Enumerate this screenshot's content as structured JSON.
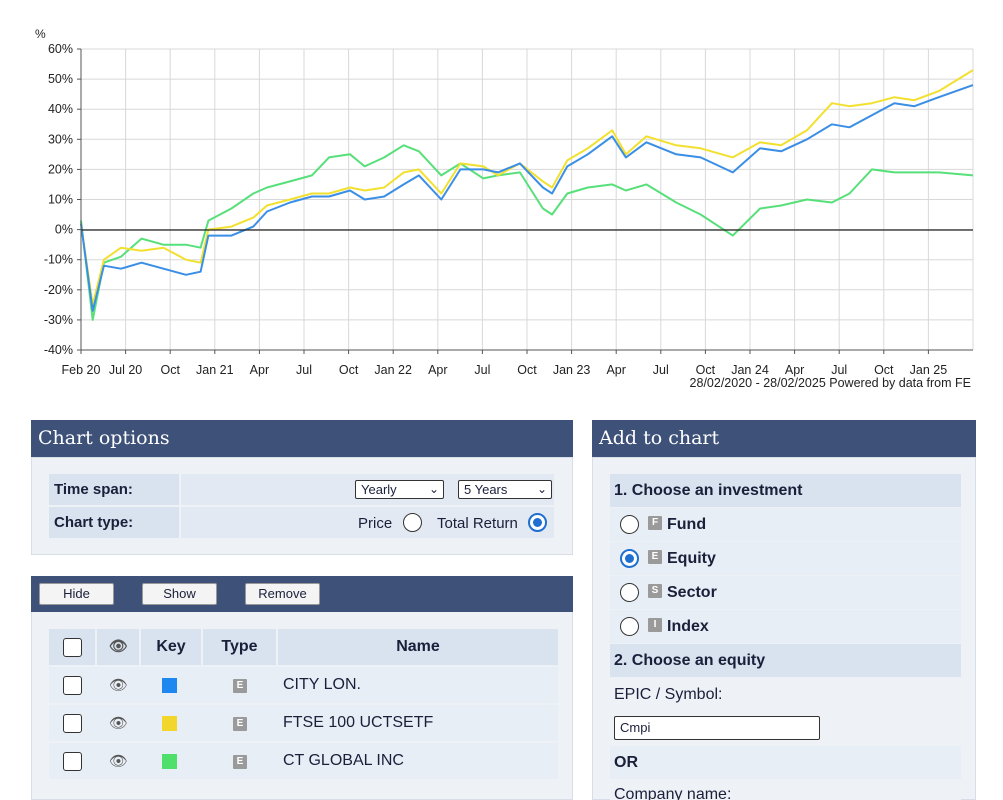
{
  "chart": {
    "y_unit": "%",
    "y_ticks": [
      "60%",
      "50%",
      "40%",
      "30%",
      "20%",
      "10%",
      "0%",
      "-10%",
      "-20%",
      "-30%",
      "-40%"
    ],
    "x_ticks": [
      "Feb 20",
      "Jul 20",
      "Oct",
      "Jan 21",
      "Apr",
      "Jul",
      "Oct",
      "Jan 22",
      "Apr",
      "Jul",
      "Oct",
      "Jan 23",
      "Apr",
      "Jul",
      "Oct",
      "Jan 24",
      "Apr",
      "Jul",
      "Oct",
      "Jan 25"
    ],
    "date_range": "28/02/2020 - 28/02/2025",
    "credit": "Powered by data from FE"
  },
  "chart_data": {
    "type": "line",
    "ylim": [
      -40,
      60
    ],
    "grid": true,
    "x_range": [
      "2020-02-28",
      "2025-02-28"
    ],
    "series": [
      {
        "name": "CITY LON.",
        "color": "#3a8ee6",
        "points": [
          [
            "2020-02-28",
            2
          ],
          [
            "2020-03-23",
            -27
          ],
          [
            "2020-04-15",
            -12
          ],
          [
            "2020-05-20",
            -13
          ],
          [
            "2020-07-01",
            -11
          ],
          [
            "2020-08-15",
            -13
          ],
          [
            "2020-09-30",
            -15
          ],
          [
            "2020-10-30",
            -14
          ],
          [
            "2020-11-15",
            -2
          ],
          [
            "2021-01-01",
            -2
          ],
          [
            "2021-02-15",
            1
          ],
          [
            "2021-03-15",
            6
          ],
          [
            "2021-05-01",
            9
          ],
          [
            "2021-06-15",
            11
          ],
          [
            "2021-07-20",
            11
          ],
          [
            "2021-09-01",
            13
          ],
          [
            "2021-10-01",
            10
          ],
          [
            "2021-11-10",
            11
          ],
          [
            "2021-12-20",
            15
          ],
          [
            "2022-01-20",
            18
          ],
          [
            "2022-03-07",
            10
          ],
          [
            "2022-04-15",
            20
          ],
          [
            "2022-06-01",
            20
          ],
          [
            "2022-07-01",
            19
          ],
          [
            "2022-08-15",
            22
          ],
          [
            "2022-10-01",
            14
          ],
          [
            "2022-10-20",
            12
          ],
          [
            "2022-11-20",
            21
          ],
          [
            "2023-01-01",
            25
          ],
          [
            "2023-02-20",
            31
          ],
          [
            "2023-03-20",
            24
          ],
          [
            "2023-05-01",
            29
          ],
          [
            "2023-07-01",
            25
          ],
          [
            "2023-08-20",
            24
          ],
          [
            "2023-10-25",
            19
          ],
          [
            "2023-12-20",
            27
          ],
          [
            "2024-02-01",
            26
          ],
          [
            "2024-03-25",
            30
          ],
          [
            "2024-05-15",
            35
          ],
          [
            "2024-06-20",
            34
          ],
          [
            "2024-08-05",
            38
          ],
          [
            "2024-09-20",
            42
          ],
          [
            "2024-10-31",
            41
          ],
          [
            "2024-12-20",
            44
          ],
          [
            "2025-02-28",
            48
          ]
        ]
      },
      {
        "name": "FTSE 100 UCTSETF",
        "color": "#f2e02f",
        "points": [
          [
            "2020-02-28",
            2
          ],
          [
            "2020-03-23",
            -25
          ],
          [
            "2020-04-15",
            -10
          ],
          [
            "2020-05-20",
            -6
          ],
          [
            "2020-07-01",
            -7
          ],
          [
            "2020-08-15",
            -6
          ],
          [
            "2020-09-30",
            -10
          ],
          [
            "2020-10-30",
            -11
          ],
          [
            "2020-11-15",
            0
          ],
          [
            "2021-01-01",
            1
          ],
          [
            "2021-02-15",
            4
          ],
          [
            "2021-03-15",
            8
          ],
          [
            "2021-05-01",
            10
          ],
          [
            "2021-06-15",
            12
          ],
          [
            "2021-07-20",
            12
          ],
          [
            "2021-09-01",
            14
          ],
          [
            "2021-10-01",
            13
          ],
          [
            "2021-11-10",
            14
          ],
          [
            "2021-12-20",
            19
          ],
          [
            "2022-01-20",
            20
          ],
          [
            "2022-03-07",
            12
          ],
          [
            "2022-04-15",
            22
          ],
          [
            "2022-06-01",
            21
          ],
          [
            "2022-07-01",
            18
          ],
          [
            "2022-08-15",
            22
          ],
          [
            "2022-10-01",
            16
          ],
          [
            "2022-10-20",
            14
          ],
          [
            "2022-11-20",
            23
          ],
          [
            "2023-01-01",
            27
          ],
          [
            "2023-02-20",
            33
          ],
          [
            "2023-03-20",
            25
          ],
          [
            "2023-05-01",
            31
          ],
          [
            "2023-07-01",
            28
          ],
          [
            "2023-08-20",
            27
          ],
          [
            "2023-10-25",
            24
          ],
          [
            "2023-12-20",
            29
          ],
          [
            "2024-02-01",
            28
          ],
          [
            "2024-03-25",
            33
          ],
          [
            "2024-05-15",
            42
          ],
          [
            "2024-06-20",
            41
          ],
          [
            "2024-08-05",
            42
          ],
          [
            "2024-09-20",
            44
          ],
          [
            "2024-10-31",
            43
          ],
          [
            "2024-12-20",
            46
          ],
          [
            "2025-02-28",
            53
          ]
        ]
      },
      {
        "name": "CT GLOBAL INC",
        "color": "#57e07a",
        "points": [
          [
            "2020-02-28",
            3
          ],
          [
            "2020-03-23",
            -30
          ],
          [
            "2020-04-15",
            -11
          ],
          [
            "2020-05-20",
            -9
          ],
          [
            "2020-07-01",
            -3
          ],
          [
            "2020-08-15",
            -5
          ],
          [
            "2020-09-30",
            -5
          ],
          [
            "2020-10-30",
            -6
          ],
          [
            "2020-11-15",
            3
          ],
          [
            "2021-01-01",
            7
          ],
          [
            "2021-02-15",
            12
          ],
          [
            "2021-03-15",
            14
          ],
          [
            "2021-05-01",
            16
          ],
          [
            "2021-06-15",
            18
          ],
          [
            "2021-07-20",
            24
          ],
          [
            "2021-09-01",
            25
          ],
          [
            "2021-10-01",
            21
          ],
          [
            "2021-11-10",
            24
          ],
          [
            "2021-12-20",
            28
          ],
          [
            "2022-01-20",
            26
          ],
          [
            "2022-03-07",
            18
          ],
          [
            "2022-04-15",
            22
          ],
          [
            "2022-06-01",
            17
          ],
          [
            "2022-07-01",
            18
          ],
          [
            "2022-08-15",
            19
          ],
          [
            "2022-10-01",
            7
          ],
          [
            "2022-10-20",
            5
          ],
          [
            "2022-11-20",
            12
          ],
          [
            "2023-01-01",
            14
          ],
          [
            "2023-02-20",
            15
          ],
          [
            "2023-03-20",
            13
          ],
          [
            "2023-05-01",
            15
          ],
          [
            "2023-07-01",
            9
          ],
          [
            "2023-08-20",
            5
          ],
          [
            "2023-10-25",
            -2
          ],
          [
            "2023-12-20",
            7
          ],
          [
            "2024-02-01",
            8
          ],
          [
            "2024-03-25",
            10
          ],
          [
            "2024-05-15",
            9
          ],
          [
            "2024-06-20",
            12
          ],
          [
            "2024-08-05",
            20
          ],
          [
            "2024-09-20",
            19
          ],
          [
            "2024-10-31",
            19
          ],
          [
            "2024-12-20",
            19
          ],
          [
            "2025-02-28",
            18
          ]
        ]
      }
    ]
  },
  "chart_options": {
    "title": "Chart options",
    "time_span_label": "Time span:",
    "interval_value": "Yearly",
    "span_value": "5 Years",
    "chart_type_label": "Chart type:",
    "price_label": "Price",
    "total_return_label": "Total Return",
    "selected_type": "Total Return"
  },
  "list_toolbar": {
    "hide_label": "Hide",
    "show_label": "Show",
    "remove_label": "Remove"
  },
  "table": {
    "headers": {
      "key": "Key",
      "type": "Type",
      "name": "Name"
    },
    "rows": [
      {
        "key_color": "#1e88f0",
        "type": "E",
        "name": "CITY LON."
      },
      {
        "key_color": "#f2d62c",
        "type": "E",
        "name": "FTSE 100 UCTSETF"
      },
      {
        "key_color": "#4fe06c",
        "type": "E",
        "name": "CT GLOBAL INC"
      }
    ]
  },
  "add_to_chart": {
    "title": "Add to chart",
    "step1": "1. Choose an investment",
    "options": [
      {
        "badge": "F",
        "label": "Fund",
        "selected": false
      },
      {
        "badge": "E",
        "label": "Equity",
        "selected": true
      },
      {
        "badge": "S",
        "label": "Sector",
        "selected": false
      },
      {
        "badge": "I",
        "label": "Index",
        "selected": false
      }
    ],
    "step2": "2. Choose an equity",
    "symbol_label": "EPIC / Symbol:",
    "symbol_value": "Cmpi",
    "or_label": "OR",
    "company_label": "Company name:"
  },
  "colors": {
    "header_bg": "#3d5179",
    "panel_bg": "#eef2f7",
    "label_bg": "#d9e3ef",
    "radio_accent": "#1f6fd1"
  }
}
